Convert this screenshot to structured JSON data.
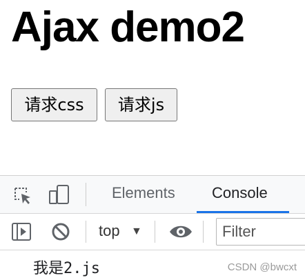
{
  "page": {
    "heading": "Ajax demo2",
    "buttons": {
      "css_label": "请求css",
      "js_label": "请求js"
    }
  },
  "devtools": {
    "icons": [
      "inspect-element-icon",
      "device-toggle-icon",
      "console-sidebar-icon",
      "clear-console-icon",
      "live-expression-eye-icon"
    ],
    "tabs": [
      {
        "label": "Elements",
        "active": false
      },
      {
        "label": "Console",
        "active": true
      }
    ],
    "toolbar": {
      "context": "top",
      "filter_placeholder": "Filter"
    },
    "console_output": [
      "我是2.js"
    ],
    "accent_color": "#1a73e8"
  },
  "watermark": "CSDN @bwcxt"
}
